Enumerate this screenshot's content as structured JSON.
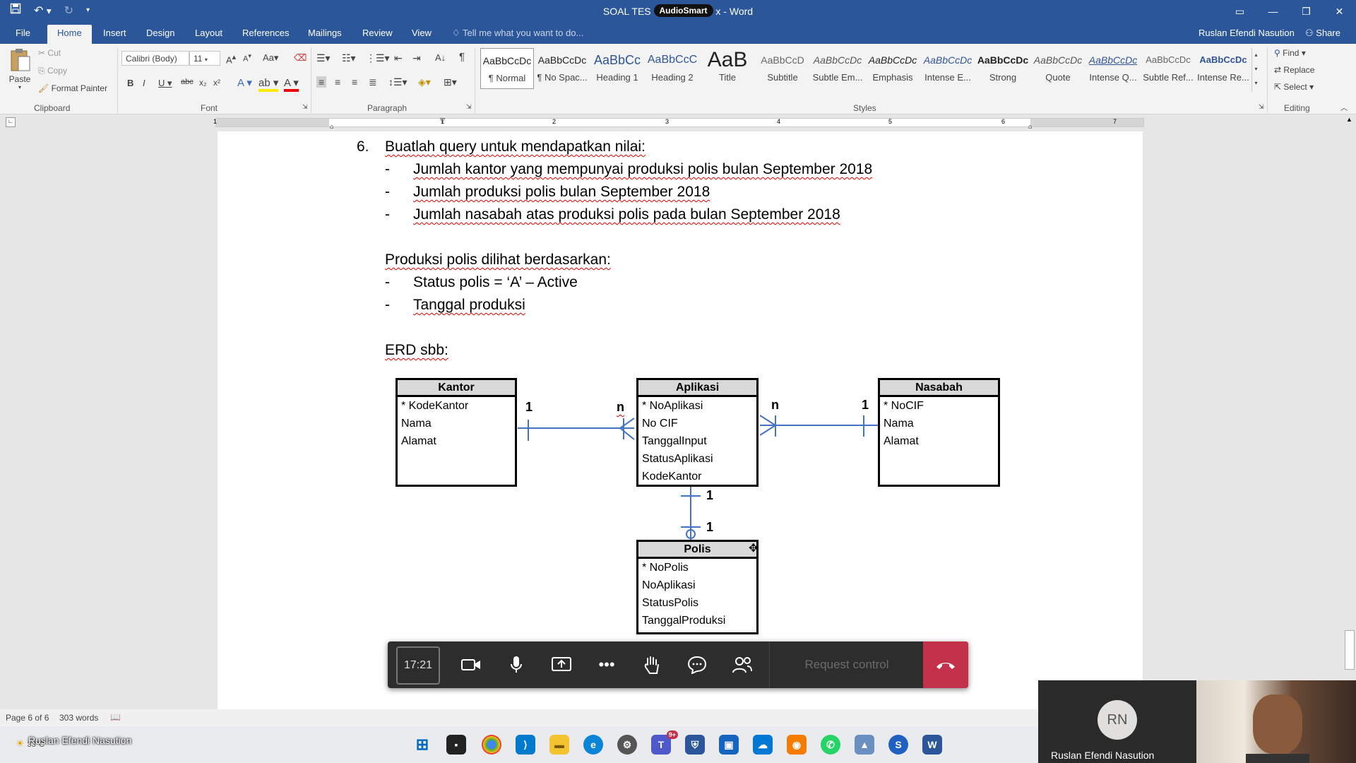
{
  "window": {
    "title": "SOAL TES",
    "title_suffix": "x - Word",
    "overlay_badge": "AudioSmart"
  },
  "tabs": [
    "File",
    "Home",
    "Insert",
    "Design",
    "Layout",
    "References",
    "Mailings",
    "Review",
    "View"
  ],
  "active_tab": "Home",
  "tell_me_placeholder": "Tell me what you want to do...",
  "user": {
    "name": "Ruslan Efendi Nasution",
    "share_label": "Share"
  },
  "clipboard": {
    "paste": "Paste",
    "cut": "Cut",
    "copy": "Copy",
    "format_painter": "Format Painter",
    "group": "Clipboard"
  },
  "font": {
    "family": "Calibri (Body)",
    "size": "11",
    "group": "Font"
  },
  "paragraph": {
    "group": "Paragraph"
  },
  "styles": {
    "group": "Styles",
    "items": [
      {
        "preview": "AaBbCcDc",
        "name": "¶ Normal"
      },
      {
        "preview": "AaBbCcDc",
        "name": "¶ No Spac..."
      },
      {
        "preview": "AaBbCc",
        "name": "Heading 1"
      },
      {
        "preview": "AaBbCcC",
        "name": "Heading 2"
      },
      {
        "preview": "AaB",
        "name": "Title"
      },
      {
        "preview": "AaBbCcD",
        "name": "Subtitle"
      },
      {
        "preview": "AaBbCcDc",
        "name": "Subtle Em..."
      },
      {
        "preview": "AaBbCcDc",
        "name": "Emphasis"
      },
      {
        "preview": "AaBbCcDc",
        "name": "Intense E..."
      },
      {
        "preview": "AaBbCcDc",
        "name": "Strong"
      },
      {
        "preview": "AaBbCcDc",
        "name": "Quote"
      },
      {
        "preview": "AaBbCcDc",
        "name": "Intense Q..."
      },
      {
        "preview": "AaBbCcDc",
        "name": "Subtle Ref..."
      },
      {
        "preview": "AaBbCcDc",
        "name": "Intense Re..."
      }
    ]
  },
  "editing": {
    "find": "Find",
    "replace": "Replace",
    "select": "Select",
    "group": "Editing"
  },
  "ruler": {
    "numbers": [
      "1",
      "1",
      "2",
      "3",
      "4",
      "5",
      "6",
      "7"
    ]
  },
  "document": {
    "q_number": "6.",
    "q_text": "Buatlah query untuk mendapatkan nilai:",
    "q_items": [
      "Jumlah kantor yang mempunyai produksi polis bulan September 2018",
      "Jumlah produksi polis bulan September 2018",
      "Jumlah nasabah atas produksi polis pada bulan September 2018"
    ],
    "dash": "-",
    "prod_title": "Produksi polis dilihat berdasarkan:",
    "prod_items": [
      "Status polis = ‘A’ – Active",
      "Tanggal produksi"
    ],
    "erd_title": "ERD sbb:"
  },
  "erd": {
    "kantor": {
      "title": "Kantor",
      "fields": [
        "* KodeKantor",
        "Nama",
        "Alamat"
      ]
    },
    "aplikasi": {
      "title": "Aplikasi",
      "fields": [
        "* NoAplikasi",
        "No CIF",
        "TanggalInput",
        "StatusAplikasi",
        "KodeKantor"
      ]
    },
    "nasabah": {
      "title": "Nasabah",
      "fields": [
        "* NoCIF",
        "Nama",
        "Alamat"
      ]
    },
    "polis": {
      "title": "Polis",
      "fields": [
        "* NoPolis",
        "NoAplikasi",
        "StatusPolis",
        "TanggalProduksi"
      ]
    },
    "cardinalities": {
      "kantor_side": "1",
      "aplikasi_left": "n",
      "aplikasi_right": "n",
      "nasabah_side": "1",
      "aplikasi_bottom": "1",
      "polis_top": "1"
    }
  },
  "teams": {
    "timer": "17:21",
    "request_control": "Request control"
  },
  "status": {
    "page": "Page 6 of 6",
    "words": "303 words"
  },
  "taskbar": {
    "weather_overlay": "Ruslan Efendi Nasution",
    "weather_temp": "33°C",
    "teams_badge": "9+"
  },
  "video": {
    "initials": "RN",
    "name": "Ruslan Efendi Nasution"
  }
}
